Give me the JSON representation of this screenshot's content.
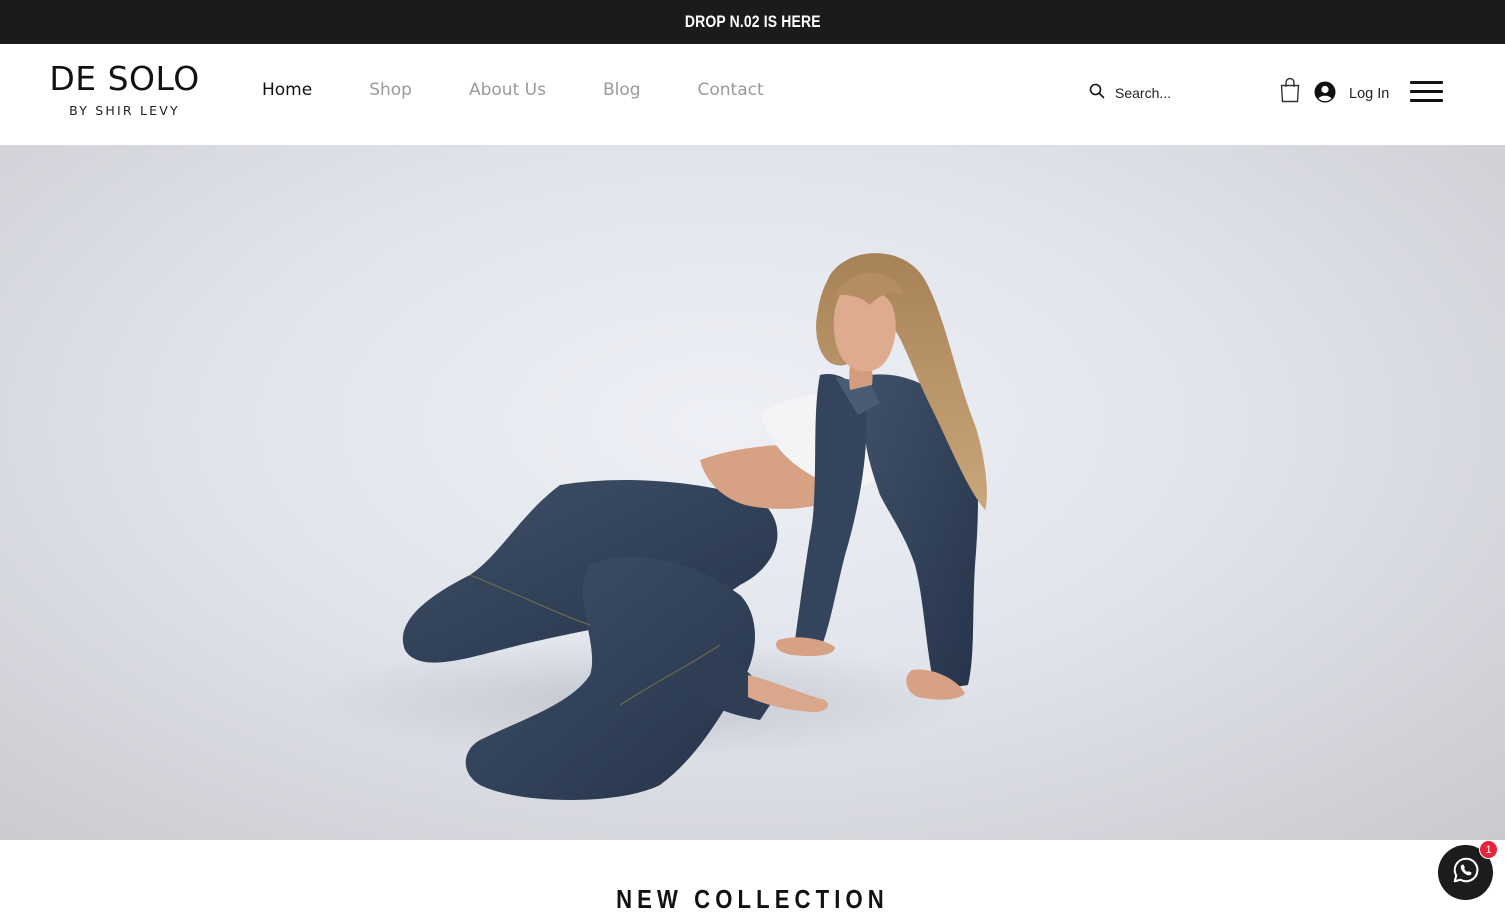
{
  "announcement": {
    "text": "DROP N.02 IS HERE"
  },
  "logo": {
    "brand": "DE SOLO",
    "subtitle": "BY SHIR LEVY"
  },
  "nav": {
    "items": [
      {
        "label": "Home",
        "active": true
      },
      {
        "label": "Shop",
        "active": false
      },
      {
        "label": "About Us",
        "active": false
      },
      {
        "label": "Blog",
        "active": false
      },
      {
        "label": "Contact",
        "active": false
      }
    ]
  },
  "search": {
    "placeholder": "Search..."
  },
  "icons": {
    "search": "search-icon",
    "cart": "shopping-bag-icon",
    "user": "user-avatar-icon",
    "menu": "hamburger-menu-icon",
    "chat": "whatsapp-icon"
  },
  "login": {
    "label": "Log In"
  },
  "hero": {
    "image": "model in denim jacket and jeans posing on floor"
  },
  "section": {
    "title": "NEW COLLECTION"
  },
  "chat_widget": {
    "badge_count": "1"
  },
  "colors": {
    "announce_bg": "#1b1b1b",
    "nav_inactive": "#9a9a9a",
    "badge": "#e8223b"
  }
}
